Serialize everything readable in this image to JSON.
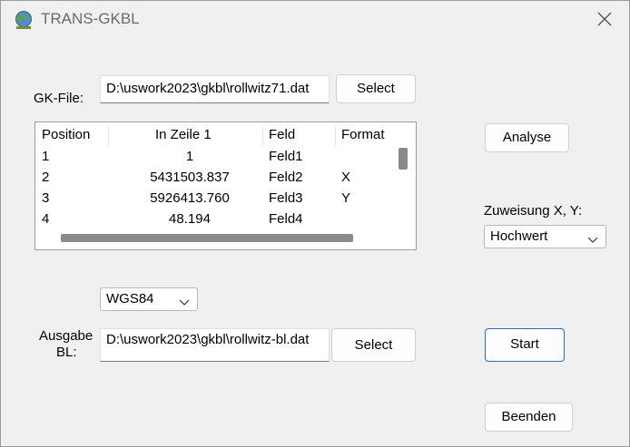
{
  "window": {
    "title": "TRANS-GKBL"
  },
  "gk_file": {
    "label": "GK-File:",
    "value": "D:\\uswork2023\\gkbl\\rollwitz71.dat",
    "select_label": "Select"
  },
  "table": {
    "columns": [
      "Position",
      "In Zeile 1",
      "Feld",
      "Format"
    ],
    "rows": [
      [
        "1",
        "1",
        "Feld1",
        ""
      ],
      [
        "2",
        "5431503.837",
        "Feld2",
        "X"
      ],
      [
        "3",
        "5926413.760",
        "Feld3",
        "Y"
      ],
      [
        "4",
        "48.194",
        "Feld4",
        ""
      ]
    ]
  },
  "analyse_label": "Analyse",
  "zuweisung": {
    "label": "Zuweisung X, Y:",
    "selected": "Hochwert"
  },
  "crs": {
    "selected": "WGS84"
  },
  "output": {
    "label_line1": "Ausgabe",
    "label_line2": "BL:",
    "value": "D:\\uswork2023\\gkbl\\rollwitz-bl.dat",
    "select_label": "Select"
  },
  "start_label": "Start",
  "exit_label": "Beenden",
  "icons": {
    "app": "globe-map-icon",
    "close": "close-icon",
    "dropdown": "chevron-down-icon"
  }
}
